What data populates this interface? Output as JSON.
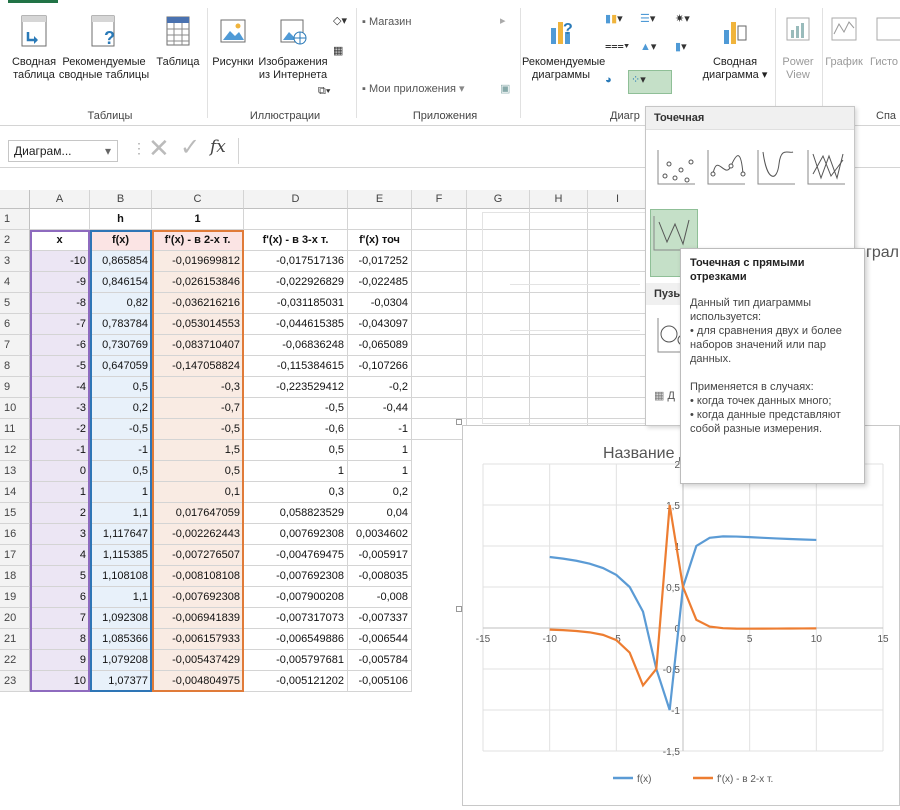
{
  "ribbon": {
    "buttons": [
      {
        "id": "pivot",
        "l1": "Сводная",
        "l2": "таблица"
      },
      {
        "id": "rec_pivot",
        "l1": "Рекомендуемые",
        "l2": "сводные таблицы"
      },
      {
        "id": "table",
        "l1": "Таблица",
        "l2": ""
      },
      {
        "id": "pictures",
        "l1": "Рисунки",
        "l2": ""
      },
      {
        "id": "online_pictures",
        "l1": "Изображения",
        "l2": "из Интернета"
      },
      {
        "id": "rec_charts",
        "l1": "Рекомендуемые",
        "l2": "диаграммы"
      },
      {
        "id": "pivot_chart",
        "l1": "Сводная",
        "l2": "диаграмма"
      },
      {
        "id": "power_view",
        "l1": "Power",
        "l2": "View"
      },
      {
        "id": "spark_line",
        "l1": "График",
        "l2": ""
      },
      {
        "id": "spark_hist",
        "l1": "Гисто",
        "l2": ""
      }
    ],
    "store": "Магазин",
    "my_apps": "Мои приложения",
    "groups": {
      "tables": "Таблицы",
      "illustrations": "Иллюстрации",
      "apps": "Приложения",
      "charts": "Диагр",
      "spark": "Спа"
    }
  },
  "formula_bar": {
    "name_box": "Диаграм...",
    "fx": "fx"
  },
  "columns": [
    "A",
    "B",
    "C",
    "D",
    "E",
    "F",
    "G",
    "H",
    "I"
  ],
  "rows": [
    {
      "n": "1",
      "a": "",
      "b": "h",
      "c": "1",
      "d": "",
      "e": ""
    },
    {
      "n": "2",
      "a": "x",
      "b": "f(x)",
      "c": "f'(x) - в 2-х т.",
      "d": "f'(x) - в 3-х т.",
      "e": "f'(x) точ"
    },
    {
      "n": "3",
      "a": "-10",
      "b": "0,865854",
      "c": "-0,019699812",
      "d": "-0,017517136",
      "e": "-0,017252"
    },
    {
      "n": "4",
      "a": "-9",
      "b": "0,846154",
      "c": "-0,026153846",
      "d": "-0,022926829",
      "e": "-0,022485"
    },
    {
      "n": "5",
      "a": "-8",
      "b": "0,82",
      "c": "-0,036216216",
      "d": "-0,031185031",
      "e": "-0,0304"
    },
    {
      "n": "6",
      "a": "-7",
      "b": "0,783784",
      "c": "-0,053014553",
      "d": "-0,044615385",
      "e": "-0,043097"
    },
    {
      "n": "7",
      "a": "-6",
      "b": "0,730769",
      "c": "-0,083710407",
      "d": "-0,06836248",
      "e": "-0,065089"
    },
    {
      "n": "8",
      "a": "-5",
      "b": "0,647059",
      "c": "-0,147058824",
      "d": "-0,115384615",
      "e": "-0,107266"
    },
    {
      "n": "9",
      "a": "-4",
      "b": "0,5",
      "c": "-0,3",
      "d": "-0,223529412",
      "e": "-0,2"
    },
    {
      "n": "10",
      "a": "-3",
      "b": "0,2",
      "c": "-0,7",
      "d": "-0,5",
      "e": "-0,44"
    },
    {
      "n": "11",
      "a": "-2",
      "b": "-0,5",
      "c": "-0,5",
      "d": "-0,6",
      "e": "-1"
    },
    {
      "n": "12",
      "a": "-1",
      "b": "-1",
      "c": "1,5",
      "d": "0,5",
      "e": "1"
    },
    {
      "n": "13",
      "a": "0",
      "b": "0,5",
      "c": "0,5",
      "d": "1",
      "e": "1"
    },
    {
      "n": "14",
      "a": "1",
      "b": "1",
      "c": "0,1",
      "d": "0,3",
      "e": "0,2"
    },
    {
      "n": "15",
      "a": "2",
      "b": "1,1",
      "c": "0,017647059",
      "d": "0,058823529",
      "e": "0,04"
    },
    {
      "n": "16",
      "a": "3",
      "b": "1,117647",
      "c": "-0,002262443",
      "d": "0,007692308",
      "e": "0,0034602"
    },
    {
      "n": "17",
      "a": "4",
      "b": "1,115385",
      "c": "-0,007276507",
      "d": "-0,004769475",
      "e": "-0,005917"
    },
    {
      "n": "18",
      "a": "5",
      "b": "1,108108",
      "c": "-0,008108108",
      "d": "-0,007692308",
      "e": "-0,008035"
    },
    {
      "n": "19",
      "a": "6",
      "b": "1,1",
      "c": "-0,007692308",
      "d": "-0,007900208",
      "e": "-0,008"
    },
    {
      "n": "20",
      "a": "7",
      "b": "1,092308",
      "c": "-0,006941839",
      "d": "-0,007317073",
      "e": "-0,007337"
    },
    {
      "n": "21",
      "a": "8",
      "b": "1,085366",
      "c": "-0,006157933",
      "d": "-0,006549886",
      "e": "-0,006544"
    },
    {
      "n": "22",
      "a": "9",
      "b": "1,079208",
      "c": "-0,005437429",
      "d": "-0,005797681",
      "e": "-0,005784"
    },
    {
      "n": "23",
      "a": "10",
      "b": "1,07377",
      "c": "-0,004804975",
      "d": "-0,005121202",
      "e": "-0,005106"
    }
  ],
  "popup": {
    "section1": "Точечная",
    "section2": "Пузы",
    "footer_icon": "Д"
  },
  "tooltip": {
    "title": "Точечная с прямыми отрезками",
    "line1": "Данный тип диаграммы",
    "line2": "используется:",
    "line3": "• для сравнения двух и более",
    "line4": "наборов значений или пар",
    "line5": "данных.",
    "line6": "Применяется в случаях:",
    "line7": "• когда точек данных много;",
    "line8": "• когда данные представляют",
    "line9": "собой разные измерения."
  },
  "behind_chart_title_fragment": "грал",
  "chart_data": {
    "type": "line",
    "title": "Название д",
    "xlim": [
      -15,
      15
    ],
    "ylim": [
      -1.5,
      2
    ],
    "x_ticks": [
      "-15",
      "-10",
      "-5",
      "0",
      "5",
      "10",
      "15"
    ],
    "y_ticks": [
      "-1,5",
      "-1",
      "-0,5",
      "0",
      "0,5",
      "1",
      "1,5",
      "2"
    ],
    "x": [
      -10,
      -9,
      -8,
      -7,
      -6,
      -5,
      -4,
      -3,
      -2,
      -1,
      0,
      1,
      2,
      3,
      4,
      5,
      6,
      7,
      8,
      9,
      10
    ],
    "series": [
      {
        "name": "f(x)",
        "color": "#5b9bd5",
        "values": [
          0.865854,
          0.846154,
          0.82,
          0.783784,
          0.730769,
          0.647059,
          0.5,
          0.2,
          -0.5,
          -1,
          0.5,
          1,
          1.1,
          1.117647,
          1.115385,
          1.108108,
          1.1,
          1.092308,
          1.085366,
          1.079208,
          1.07377
        ]
      },
      {
        "name": "f'(x) - в 2-х т.",
        "color": "#ed7d31",
        "values": [
          -0.019699812,
          -0.026153846,
          -0.036216216,
          -0.053014553,
          -0.083710407,
          -0.147058824,
          -0.3,
          -0.7,
          -0.5,
          1.5,
          0.5,
          0.1,
          0.017647059,
          -0.002262443,
          -0.007276507,
          -0.008108108,
          -0.007692308,
          -0.006941839,
          -0.006157933,
          -0.005437429,
          -0.004804975
        ]
      }
    ],
    "legend": "bottom",
    "grid": true
  }
}
